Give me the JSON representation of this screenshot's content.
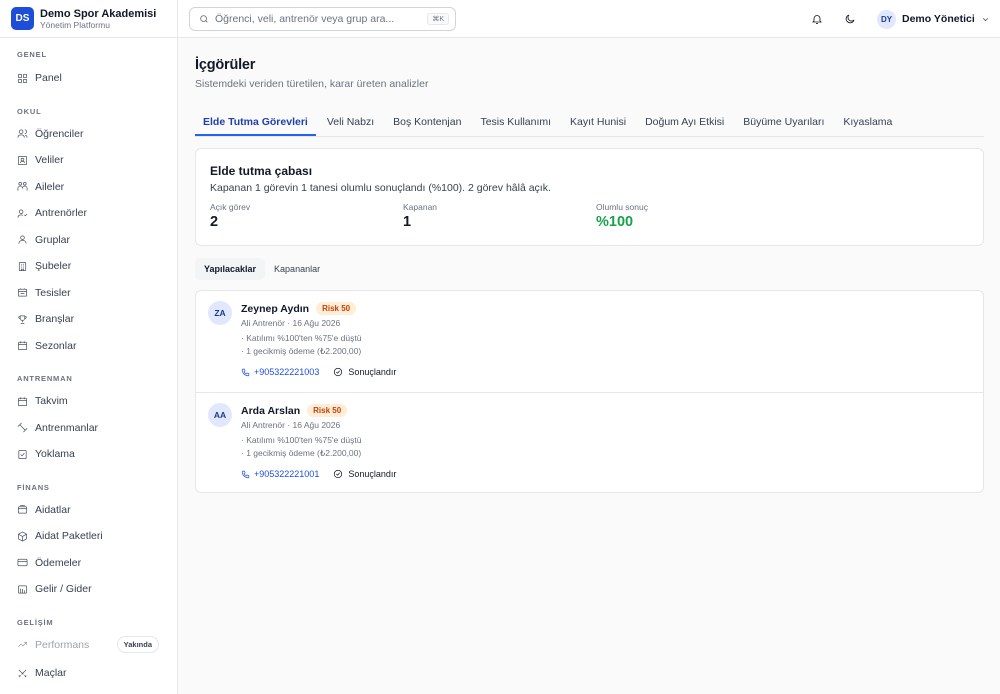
{
  "brand": {
    "logo": "DS",
    "name": "Demo Spor Akademisi",
    "subtitle": "Yönetim Platformu"
  },
  "sidebar": {
    "sections": [
      {
        "title": "GENEL",
        "items": [
          {
            "label": "Panel",
            "icon": "layout-grid-icon"
          }
        ]
      },
      {
        "title": "OKUL",
        "items": [
          {
            "label": "Öğrenciler",
            "icon": "users-icon"
          },
          {
            "label": "Veliler",
            "icon": "contact-card-icon"
          },
          {
            "label": "Aileler",
            "icon": "family-icon"
          },
          {
            "label": "Antrenörler",
            "icon": "coach-icon"
          },
          {
            "label": "Gruplar",
            "icon": "group-icon"
          },
          {
            "label": "Şubeler",
            "icon": "building-icon"
          },
          {
            "label": "Tesisler",
            "icon": "facility-icon"
          },
          {
            "label": "Branşlar",
            "icon": "trophy-icon"
          },
          {
            "label": "Sezonlar",
            "icon": "calendar-icon"
          }
        ]
      },
      {
        "title": "ANTRENMAN",
        "items": [
          {
            "label": "Takvim",
            "icon": "calendar-days-icon"
          },
          {
            "label": "Antrenmanlar",
            "icon": "dumbbell-icon"
          },
          {
            "label": "Yoklama",
            "icon": "checklist-icon"
          }
        ]
      },
      {
        "title": "FİNANS",
        "items": [
          {
            "label": "Aidatlar",
            "icon": "receipt-icon"
          },
          {
            "label": "Aidat Paketleri",
            "icon": "package-icon"
          },
          {
            "label": "Ödemeler",
            "icon": "credit-card-icon"
          },
          {
            "label": "Gelir / Gider",
            "icon": "wallet-icon"
          }
        ]
      },
      {
        "title": "GELİŞİM",
        "items": [
          {
            "label": "Performans",
            "icon": "trend-up-icon",
            "badge": "Yakında"
          },
          {
            "label": "Maçlar",
            "icon": "swords-icon"
          }
        ]
      }
    ]
  },
  "topbar": {
    "search_placeholder": "Öğrenci, veli, antrenör veya grup ara...",
    "shortcut": "⌘K",
    "user_initials": "DY",
    "user_name": "Demo Yönetici"
  },
  "page": {
    "title": "İçgörüler",
    "subtitle": "Sistemdeki veriden türetilen, karar üreten analizler",
    "tabs": [
      "Elde Tutma Görevleri",
      "Veli Nabzı",
      "Boş Kontenjan",
      "Tesis Kullanımı",
      "Kayıt Hunisi",
      "Doğum Ayı Etkisi",
      "Büyüme Uyarıları",
      "Kıyaslama"
    ]
  },
  "summary": {
    "title": "Elde tutma çabası",
    "description": "Kapanan 1 görevin 1 tanesi olumlu sonuçlandı (%100). 2 görev hâlâ açık.",
    "stats": [
      {
        "label": "Açık görev",
        "value": "2"
      },
      {
        "label": "Kapanan",
        "value": "1"
      },
      {
        "label": "Olumlu sonuç",
        "value": "%100"
      }
    ],
    "success_color": "#16a34a"
  },
  "subtabs": [
    "Yapılacaklar",
    "Kapananlar"
  ],
  "tasks": [
    {
      "initials": "ZA",
      "name": "Zeynep Aydın",
      "risk": "Risk 50",
      "meta": "Ali Antrenör · 16 Ağu 2026",
      "reasons": [
        "· Katılımı %100'ten %75'e düştü",
        "· 1 gecikmiş ödeme (₺2.200,00)"
      ],
      "phone": "+905322221003",
      "action": "Sonuçlandır"
    },
    {
      "initials": "AA",
      "name": "Arda Arslan",
      "risk": "Risk 50",
      "meta": "Ali Antrenör · 16 Ağu 2026",
      "reasons": [
        "· Katılımı %100'ten %75'e düştü",
        "· 1 gecikmiş ödeme (₺2.200,00)"
      ],
      "phone": "+905322221001",
      "action": "Sonuçlandır"
    }
  ]
}
